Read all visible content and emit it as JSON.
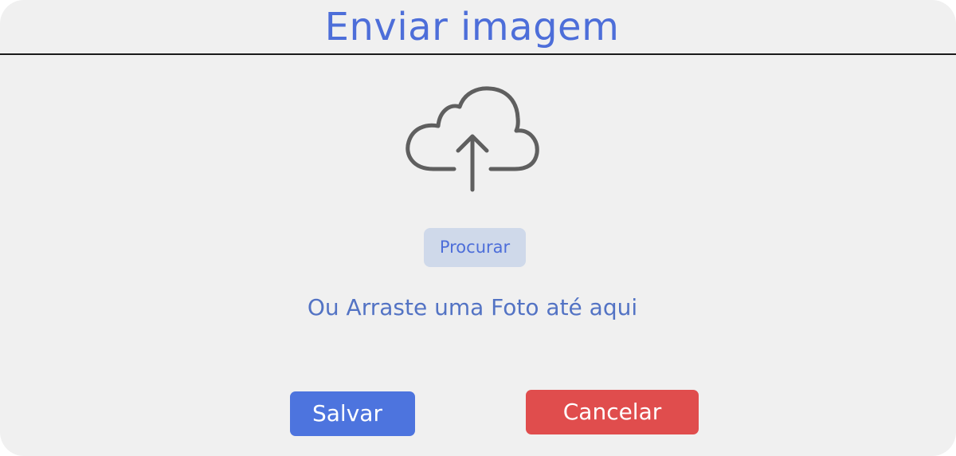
{
  "dialog": {
    "title": "Enviar imagem",
    "upload_icon": "cloud-upload-icon",
    "browse_label": "Procurar",
    "drag_hint": "Ou Arraste uma Foto até aqui",
    "save_label": "Salvar",
    "cancel_label": "Cancelar"
  },
  "colors": {
    "accent": "#4d6ed9",
    "save": "#4d74de",
    "cancel": "#e04d4d",
    "browse_bg": "#cfd9ea",
    "background": "#f0f0f0",
    "icon": "#5f5f5f"
  }
}
